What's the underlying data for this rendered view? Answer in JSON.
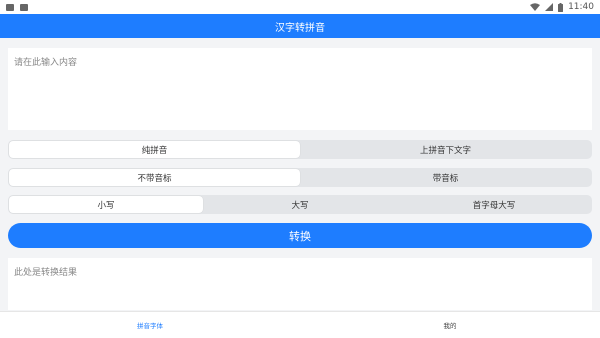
{
  "status_bar": {
    "time": "11:40"
  },
  "app_bar": {
    "title": "汉字转拼音"
  },
  "input": {
    "placeholder": "请在此输入内容",
    "value": ""
  },
  "mode_segment": {
    "options": [
      "纯拼音",
      "上拼音下文字"
    ],
    "selected": "纯拼音"
  },
  "tone_segment": {
    "options": [
      "不带音标",
      "带音标"
    ],
    "selected": "不带音标"
  },
  "case_segment": {
    "options": [
      "小写",
      "大写",
      "首字母大写"
    ],
    "selected": "小写"
  },
  "convert_button": {
    "label": "转换"
  },
  "result": {
    "placeholder": "此处是转换结果"
  },
  "bottom_nav": {
    "items": [
      {
        "label": "拼音字体",
        "active": true
      },
      {
        "label": "我的",
        "active": false
      }
    ]
  },
  "colors": {
    "accent": "#1e7dff",
    "segment_bg": "#e3e5e8",
    "page_bg": "#f3f4f6"
  }
}
